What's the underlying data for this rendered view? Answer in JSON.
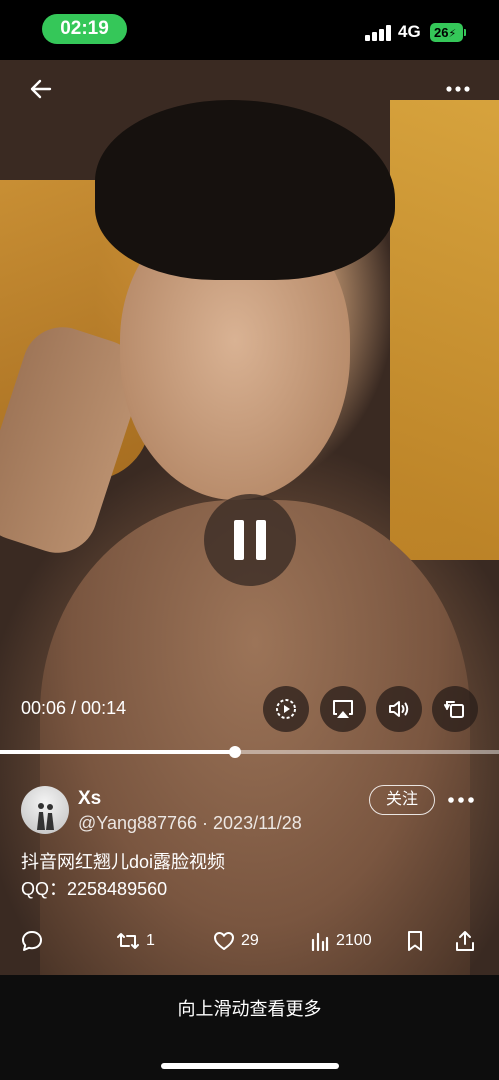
{
  "status_bar": {
    "time": "02:19",
    "network": "4G",
    "battery": "26",
    "time_pill_color": "#35c759"
  },
  "nav": {
    "back_icon": "arrow-left-icon",
    "more_icon": "more-horizontal-icon"
  },
  "player": {
    "state_icon": "pause-icon",
    "current_time": "00:06",
    "duration": "00:14",
    "time_display": "00:06 / 00:14",
    "progress_fraction": 0.47,
    "controls": [
      {
        "name": "playback-speed-button",
        "icon": "playback-speed-icon"
      },
      {
        "name": "airplay-button",
        "icon": "airplay-icon"
      },
      {
        "name": "volume-button",
        "icon": "volume-icon"
      },
      {
        "name": "rotate-button",
        "icon": "rotate-icon"
      }
    ]
  },
  "post": {
    "username": "Xs",
    "handle_date": "@Yang887766 · 2023/11/28",
    "follow_label": "关注",
    "caption_line1": "抖音网红翘儿doi露脸视频",
    "caption_line2": "QQ：2258489560"
  },
  "actions": {
    "comment_icon": "comment-icon",
    "retweet_icon": "retweet-icon",
    "retweet_count": "1",
    "like_icon": "heart-icon",
    "like_count": "29",
    "views_icon": "bar-chart-icon",
    "views_count": "2100",
    "bookmark_icon": "bookmark-icon",
    "share_icon": "share-icon"
  },
  "bottom": {
    "swipe_hint": "向上滑动查看更多"
  }
}
